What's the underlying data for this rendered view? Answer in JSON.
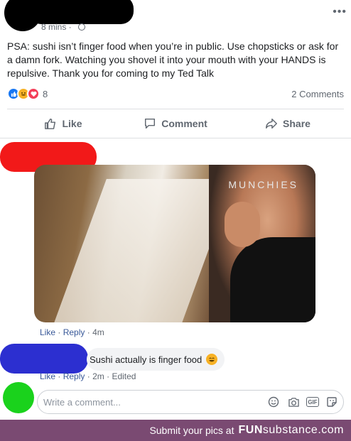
{
  "post": {
    "time": "8 mins",
    "more_label": "•••",
    "text": "PSA: sushi isn’t finger food when you’re in public. Use chopsticks or ask for a damn fork. Watching you shovel it into your mouth with your HANDS is repulsive. Thank you for coming to my Ted Talk",
    "reaction_count": "8",
    "comments_count": "2 Comments",
    "actions": {
      "like": "Like",
      "comment": "Comment",
      "share": "Share"
    }
  },
  "comments": [
    {
      "gif_watermark": "MUNCHIES",
      "like": "Like",
      "reply": "Reply",
      "time": "4m"
    },
    {
      "text": "Sushi actually is finger food",
      "like": "Like",
      "reply": "Reply",
      "time": "2m",
      "edited": "Edited"
    }
  ],
  "composer": {
    "placeholder": "Write a comment...",
    "icons": [
      "emoji-icon",
      "camera-icon",
      "gif-icon",
      "sticker-icon"
    ],
    "gif_label": "GIF"
  },
  "footer": {
    "text": "Submit your pics at",
    "brand_fun": "FUN",
    "brand_sub": "substance",
    "brand_tld": ".com"
  },
  "colors": {
    "footer_bg": "#7a4a72",
    "link": "#385898",
    "like_reaction": "#1877f2",
    "haha_reaction": "#f7b125",
    "love_reaction": "#f33e58"
  }
}
